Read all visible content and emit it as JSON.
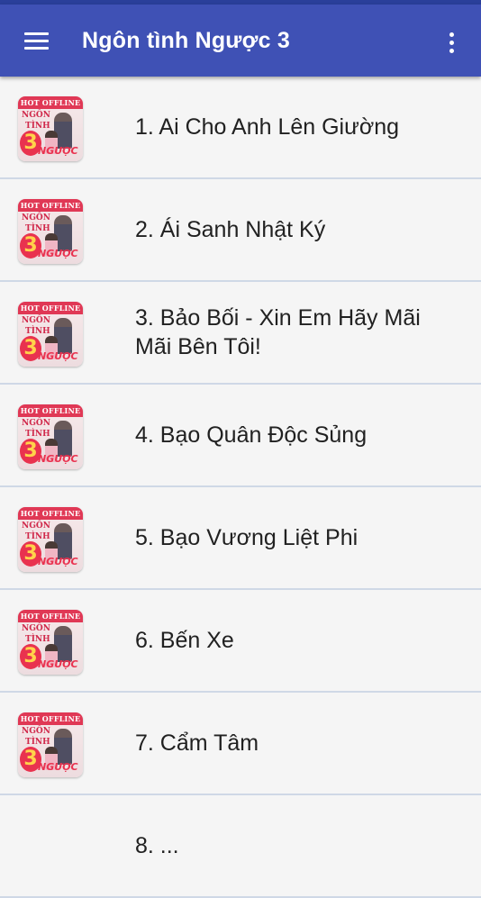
{
  "appbar": {
    "title": "Ngôn tình Ngược 3",
    "menu_icon": "hamburger-menu-icon",
    "overflow_icon": "more-vert-icon",
    "color": "#3f51b5"
  },
  "thumbnail": {
    "banner": "HOT OFFLINE",
    "word1": "NGÔN",
    "word2": "TÌNH",
    "number": "3",
    "tag": "NGƯỢC"
  },
  "list": {
    "items": [
      {
        "label": "1. Ai Cho Anh Lên Giường"
      },
      {
        "label": "2. Ái Sanh Nhật Ký"
      },
      {
        "label": "3. Bảo Bối - Xin Em Hãy Mãi Mãi Bên Tôi!"
      },
      {
        "label": "4. Bạo Quân Độc Sủng"
      },
      {
        "label": "5. Bạo Vương Liệt Phi"
      },
      {
        "label": "6. Bến Xe"
      },
      {
        "label": "7. Cẩm Tâm"
      },
      {
        "label": "8. ..."
      }
    ]
  }
}
